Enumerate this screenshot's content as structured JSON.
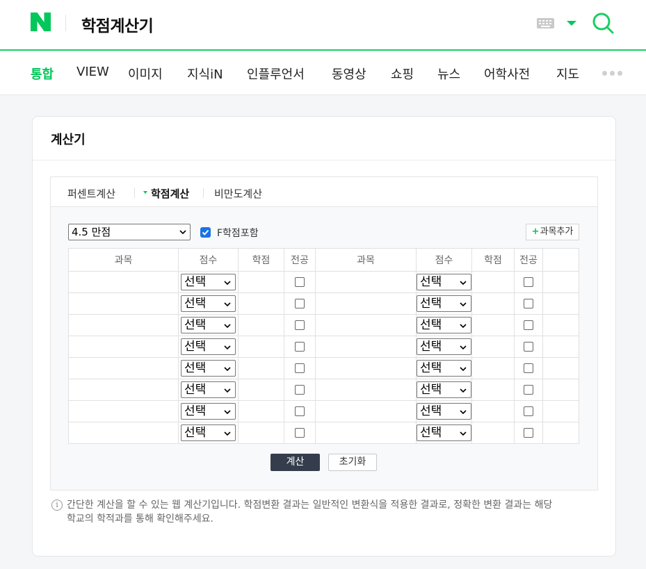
{
  "header": {
    "query": "학점계산기",
    "logo_letter": "N",
    "brand_color": "#03c75a"
  },
  "nav": {
    "tabs": [
      {
        "label": "통합",
        "active": true
      },
      {
        "label": "VIEW"
      },
      {
        "label": "이미지"
      },
      {
        "label": "지식iN"
      },
      {
        "label": "인플루언서"
      },
      {
        "label": "동영상"
      },
      {
        "label": "쇼핑"
      },
      {
        "label": "뉴스"
      },
      {
        "label": "어학사전"
      },
      {
        "label": "지도"
      }
    ]
  },
  "card": {
    "title": "계산기",
    "calc_tabs": [
      "퍼센트계산",
      "학점계산",
      "비만도계산"
    ],
    "active_calc_tab": "학점계산",
    "scale_value": "4.5 만점",
    "f_include_label": "F학점포함",
    "f_include_checked": true,
    "add_subject_label": "과목추가",
    "table": {
      "headers": [
        "과목",
        "점수",
        "학점",
        "전공",
        "과목",
        "점수",
        "학점",
        "전공"
      ],
      "rows": [
        {
          "left_grade": "선택",
          "right_grade": "선택"
        },
        {
          "left_grade": "선택",
          "right_grade": "선택"
        },
        {
          "left_grade": "선택",
          "right_grade": "선택"
        },
        {
          "left_grade": "선택",
          "right_grade": "선택"
        },
        {
          "left_grade": "선택",
          "right_grade": "선택"
        },
        {
          "left_grade": "선택",
          "right_grade": "선택"
        },
        {
          "left_grade": "선택",
          "right_grade": "선택"
        },
        {
          "left_grade": "선택",
          "right_grade": "선택"
        }
      ]
    },
    "calculate_label": "계산",
    "reset_label": "초기화",
    "note_line1": "간단한 계산을 할 수 있는 웹 계산기입니다. 학점변환 결과는 일반적인 변환식을 적용한 결과로, 정확한 변환 결과는 해당",
    "note_line2": "학교의 학적과를 통해 확인해주세요."
  }
}
